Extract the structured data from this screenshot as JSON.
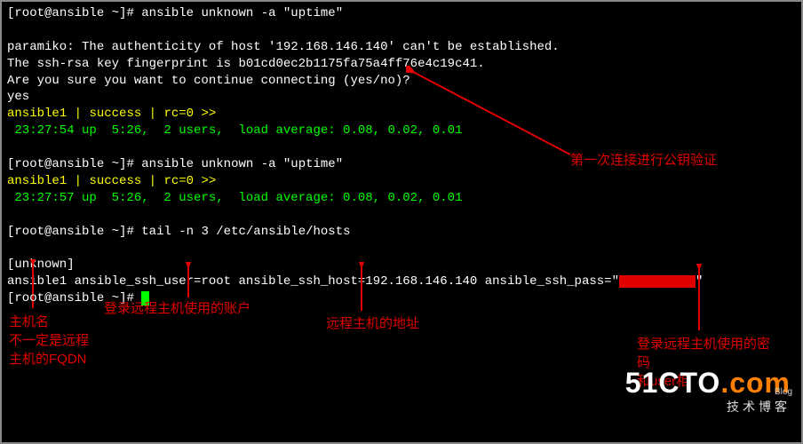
{
  "prompt": {
    "user": "root",
    "host": "ansible",
    "dir": "~",
    "symbol": "#"
  },
  "cmd1": "ansible unknown -a \"uptime\"",
  "paramiko": {
    "l1": "paramiko: The authenticity of host '192.168.146.140' can't be established.",
    "l2": "The ssh-rsa key fingerprint is b01cd0ec2b1175fa75a4ff76e4c19c41.",
    "l3": "Are you sure you want to continue connecting (yes/no)?",
    "ans": "yes"
  },
  "run1": {
    "host": "ansible1",
    "status": "success",
    "rc": "rc=0",
    "arrows": ">>",
    "uptime": " 23:27:54 up  5:26,  2 users,  load average: 0.08, 0.02, 0.01"
  },
  "cmd2": "ansible unknown -a \"uptime\"",
  "run2": {
    "host": "ansible1",
    "status": "success",
    "rc": "rc=0",
    "arrows": ">>",
    "uptime": " 23:27:57 up  5:26,  2 users,  load average: 0.08, 0.02, 0.01"
  },
  "cmd3": "tail -n 3 /etc/ansible/hosts",
  "hostsfile": {
    "group": "[unknown]",
    "entry_host": "ansible1",
    "entry_user_key": "ansible_ssh_user=",
    "entry_user_val": "root",
    "entry_host_key": "ansible_ssh_host=",
    "entry_host_val": "192.168.146.140",
    "entry_pass_key": "ansible_ssh_pass=",
    "entry_quote": "\""
  },
  "annot": {
    "pubkey": "第一次连接进行公钥验证",
    "hostname1": "主机名",
    "hostname2": "不一定是远程",
    "hostname3": "主机的FQDN",
    "user": "登录远程主机使用的账户",
    "addr": "远程主机的地址",
    "pass1": "登录远程主机使用的密",
    "pass2": "码",
    "pass3": "和user相"
  },
  "watermark": {
    "brand1": "51CTO",
    "brand2": ".com",
    "sub": "技术博客",
    "blog": "Blog"
  }
}
